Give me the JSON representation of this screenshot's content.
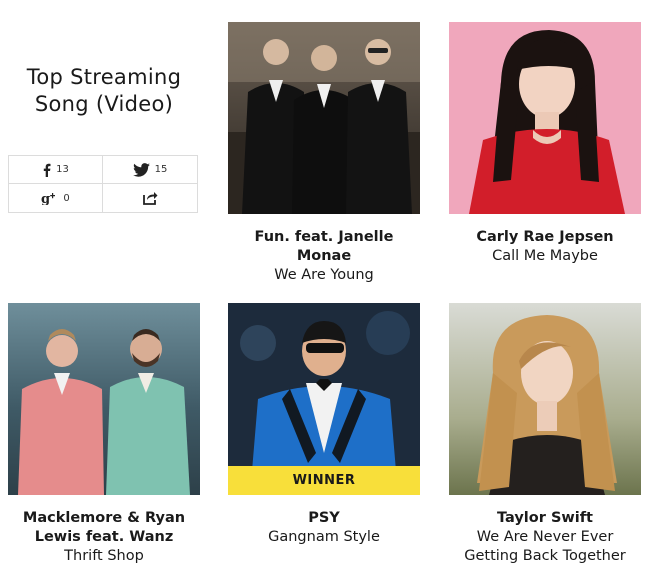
{
  "category": {
    "title_line1": "Top Streaming",
    "title_line2": "Song (Video)"
  },
  "share": {
    "facebook": {
      "icon": "facebook-icon",
      "count": "13"
    },
    "twitter": {
      "icon": "twitter-icon",
      "count": "15"
    },
    "googleplus": {
      "icon": "google-plus-icon",
      "count": "0"
    },
    "share": {
      "icon": "share-arrow-icon"
    }
  },
  "nominees": [
    {
      "artist": "Fun. feat. Janelle Monae",
      "song": "We Are Young"
    },
    {
      "artist": "Carly Rae Jepsen",
      "song": "Call Me Maybe"
    },
    {
      "artist": "Macklemore & Ryan Lewis feat. Wanz",
      "song": "Thrift Shop"
    },
    {
      "artist": "PSY",
      "song": "Gangnam Style",
      "badge": "WINNER"
    },
    {
      "artist": "Taylor Swift",
      "song": "We Are Never Ever Getting Back Together"
    }
  ],
  "colors": {
    "winner_band": "#f8df3a",
    "border": "#dcdcdc",
    "text": "#1a1a1a"
  }
}
